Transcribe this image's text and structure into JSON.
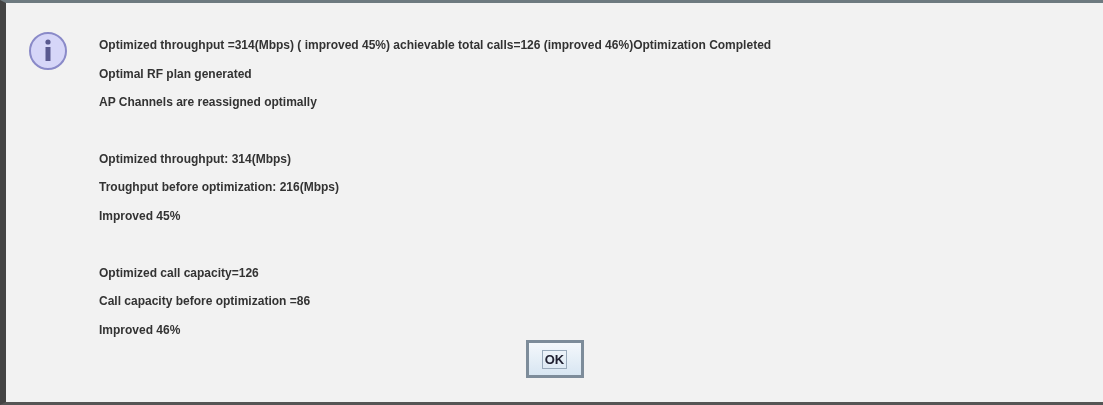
{
  "message": {
    "paragraphs": [
      {
        "lines": [
          "Optimized throughput =314(Mbps) ( improved 45%)  achievable total calls=126 (improved 46%)Optimization Completed",
          "Optimal RF plan generated",
          "AP Channels are reassigned optimally"
        ]
      },
      {
        "lines": [
          "Optimized throughput: 314(Mbps)",
          "Troughput before optimization: 216(Mbps)",
          "Improved 45%"
        ]
      },
      {
        "lines": [
          "Optimized call capacity=126",
          "Call capacity before optimization =86",
          "Improved 46%"
        ]
      }
    ]
  },
  "buttons": [
    {
      "label": "OK",
      "focused": true
    }
  ]
}
